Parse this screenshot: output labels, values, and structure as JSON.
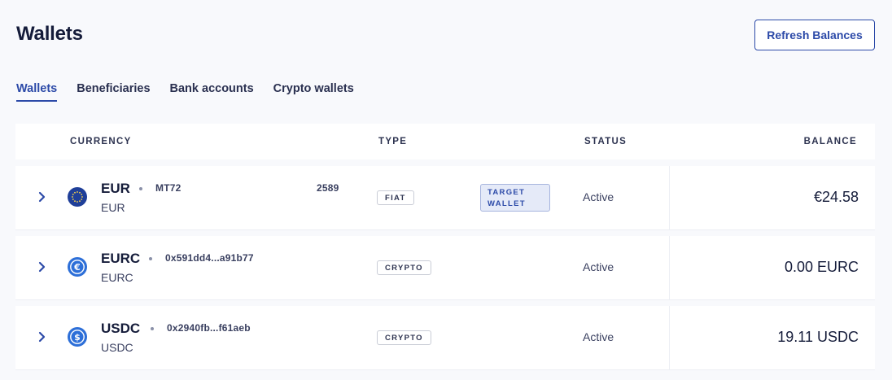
{
  "header": {
    "title": "Wallets",
    "refresh_label": "Refresh Balances"
  },
  "tabs": [
    {
      "label": "Wallets",
      "active": true
    },
    {
      "label": "Beneficiaries",
      "active": false
    },
    {
      "label": "Bank accounts",
      "active": false
    },
    {
      "label": "Crypto wallets",
      "active": false
    }
  ],
  "table": {
    "columns": {
      "currency": "CURRENCY",
      "type": "TYPE",
      "status": "STATUS",
      "balance": "BALANCE"
    },
    "rows": [
      {
        "code": "EUR",
        "subtitle": "EUR",
        "address_prefix": "MT72",
        "address_suffix": "2589",
        "type": "FIAT",
        "target_line1": "TARGET",
        "target_line2": "WALLET",
        "status": "Active",
        "balance": "€24.58",
        "icon": "eu-stars-icon"
      },
      {
        "code": "EURC",
        "subtitle": "EURC",
        "address": "0x591dd4...a91b77",
        "type": "CRYPTO",
        "status": "Active",
        "balance": "0.00 EURC",
        "icon": "eurc-coin-icon"
      },
      {
        "code": "USDC",
        "subtitle": "USDC",
        "address": "0x2940fb...f61aeb",
        "type": "CRYPTO",
        "status": "Active",
        "balance": "19.11 USDC",
        "icon": "usdc-coin-icon"
      }
    ]
  },
  "colors": {
    "accent": "#2c4aa8",
    "title": "#151c3a",
    "badge_highlight_bg": "#e5eaf8",
    "page_bg": "#f8f9fc",
    "eur_icon": "#1f3f99",
    "coin_icon": "#2d6fd8"
  }
}
